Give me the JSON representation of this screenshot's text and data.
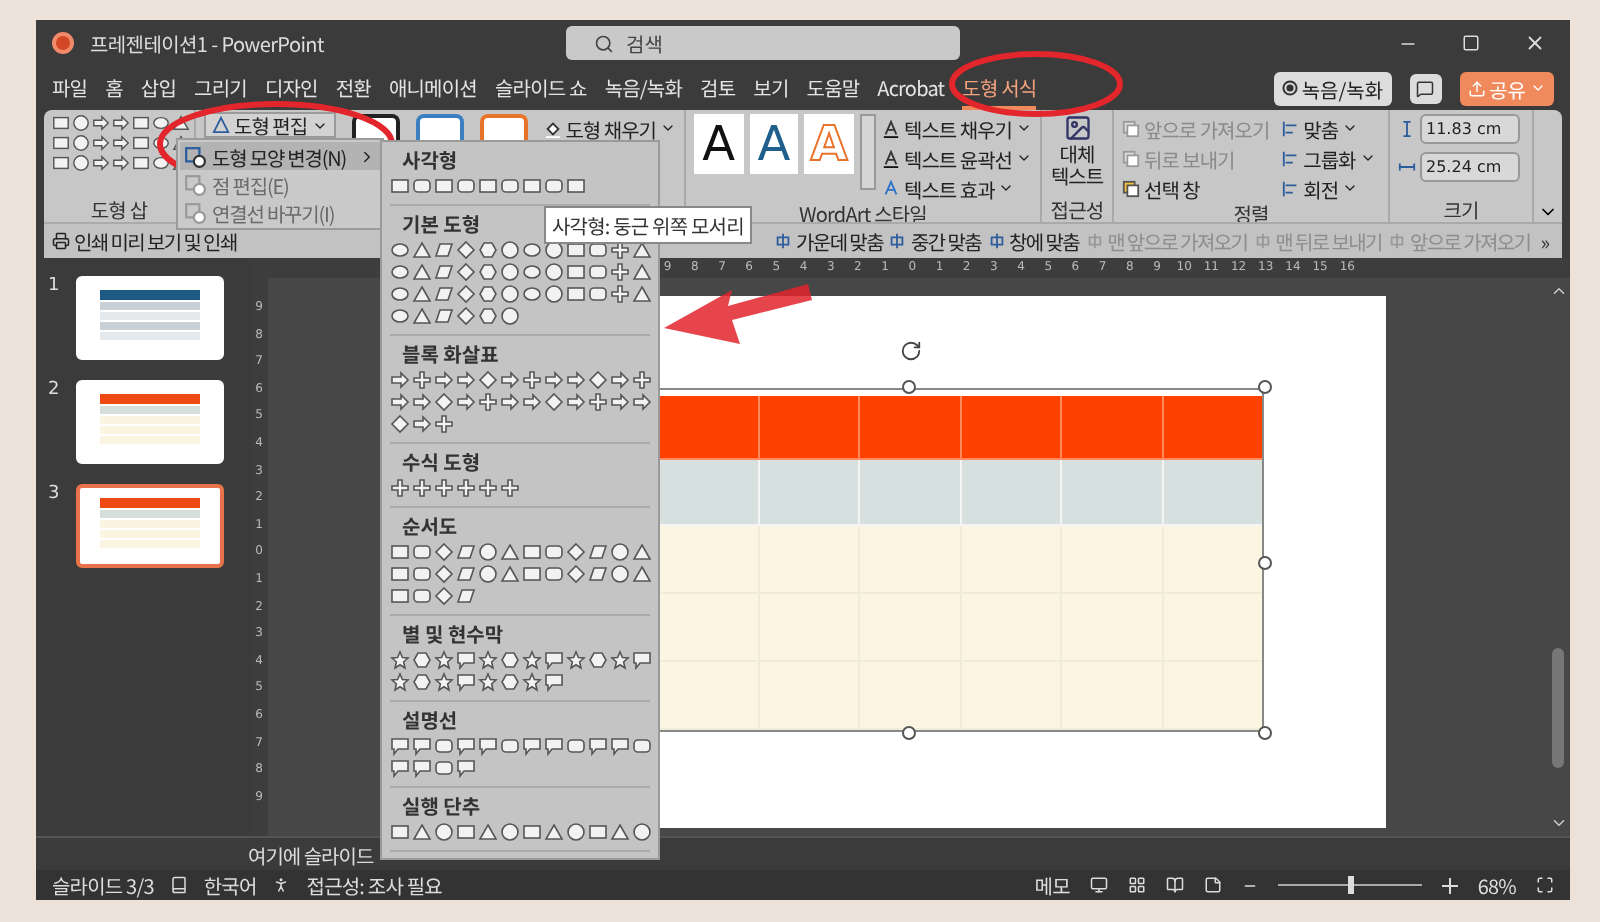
{
  "window": {
    "title": "프레젠테이션1 - PowerPoint",
    "search_placeholder": "검색"
  },
  "menu_tabs": [
    {
      "label": "파일",
      "selected": false
    },
    {
      "label": "홈",
      "selected": false
    },
    {
      "label": "삽입",
      "selected": false
    },
    {
      "label": "그리기",
      "selected": false
    },
    {
      "label": "디자인",
      "selected": false
    },
    {
      "label": "전환",
      "selected": false
    },
    {
      "label": "애니메이션",
      "selected": false
    },
    {
      "label": "슬라이드 쇼",
      "selected": false
    },
    {
      "label": "녹음/녹화",
      "selected": false
    },
    {
      "label": "검토",
      "selected": false
    },
    {
      "label": "보기",
      "selected": false
    },
    {
      "label": "도움말",
      "selected": false
    },
    {
      "label": "Acrobat",
      "selected": false
    },
    {
      "label": "도형 서식",
      "selected": true
    }
  ],
  "header_buttons": {
    "record": "녹음/녹화",
    "share": "공유"
  },
  "ribbon": {
    "insert_label": "도형 삽",
    "edit_shape": "도형 편집",
    "shape_fill": "도형 채우기",
    "wordart_samples": [
      {
        "letter": "A",
        "kind": "solid"
      },
      {
        "letter": "A",
        "kind": "blue"
      },
      {
        "letter": "A",
        "kind": "outline"
      }
    ],
    "text_commands": [
      "텍스트 채우기",
      "텍스트 윤곽선",
      "텍스트 효과"
    ],
    "wordart_label": "WordArt 스타일",
    "alt_text": "대체 텍스트",
    "accessibility_label": "접근성",
    "arrange_left": [
      {
        "label": "앞으로 가져오기",
        "disabled": true
      },
      {
        "label": "뒤로 보내기",
        "disabled": true
      },
      {
        "label": "선택 창",
        "disabled": false
      }
    ],
    "arrange_right": [
      "맞춤",
      "그룹화",
      "회전"
    ],
    "arrange_label": "정렬",
    "size_fields": [
      "11.83 cm",
      "25.24 cm"
    ],
    "size_label": "크기"
  },
  "edit_menu": [
    {
      "label": "도형 모양 변경(N)",
      "disabled": false,
      "selected": true
    },
    {
      "label": "점 편집(E)",
      "disabled": true,
      "selected": false
    },
    {
      "label": "연결선 바꾸기(I)",
      "disabled": true,
      "selected": false
    }
  ],
  "shape_gallery": {
    "sections": [
      {
        "title": "사각형"
      },
      {
        "title": "기본 도형"
      },
      {
        "title": "블록 화살표"
      },
      {
        "title": "수식 도형"
      },
      {
        "title": "순서도"
      },
      {
        "title": "별 및 현수막"
      },
      {
        "title": "설명선"
      },
      {
        "title": "실행 단추"
      }
    ],
    "tooltip": "사각형: 둥근 위쪽 모서리"
  },
  "quick_access": [
    {
      "label": "인쇄 미리 보기 및 인쇄",
      "disabled": false
    },
    {
      "label": "가운데 맞춤",
      "disabled": false
    },
    {
      "label": "중간 맞춤",
      "disabled": false
    },
    {
      "label": "창에 맞춤",
      "disabled": false
    },
    {
      "label": "맨 앞으로 가져오기",
      "disabled": true
    },
    {
      "label": "맨 뒤로 보내기",
      "disabled": true
    },
    {
      "label": "앞으로 가져오기",
      "disabled": true
    }
  ],
  "more_commands": "»",
  "ruler": {
    "horizontal": [
      "9",
      "8",
      "7",
      "6",
      "5",
      "4",
      "3",
      "2",
      "1",
      "0",
      "1",
      "2",
      "3",
      "4",
      "5",
      "6",
      "7",
      "8",
      "9",
      "10",
      "11",
      "12",
      "13",
      "14",
      "15",
      "16"
    ],
    "vertical": [
      "9",
      "8",
      "7",
      "6",
      "5",
      "4",
      "3",
      "2",
      "1",
      "0",
      "1",
      "2",
      "3",
      "4",
      "5",
      "6",
      "7",
      "8",
      "9"
    ]
  },
  "slides": [
    {
      "number": "1",
      "selected": false,
      "kind": "blue"
    },
    {
      "number": "2",
      "selected": false,
      "kind": "orange"
    },
    {
      "number": "3",
      "selected": true,
      "kind": "orange"
    }
  ],
  "slide_table": {
    "rows": [
      {
        "kind": "header"
      },
      {
        "kind": "band"
      },
      {
        "kind": "body"
      },
      {
        "kind": "body"
      },
      {
        "kind": "body"
      }
    ]
  },
  "notes": "여기에 슬라이드",
  "status_bar": {
    "slide": "슬라이드 3/3",
    "language": "한국어",
    "accessibility": "접근성: 조사 필요",
    "notes_button": "메모",
    "zoom": "68%",
    "zoom_slider": {
      "level": 0.5
    }
  }
}
